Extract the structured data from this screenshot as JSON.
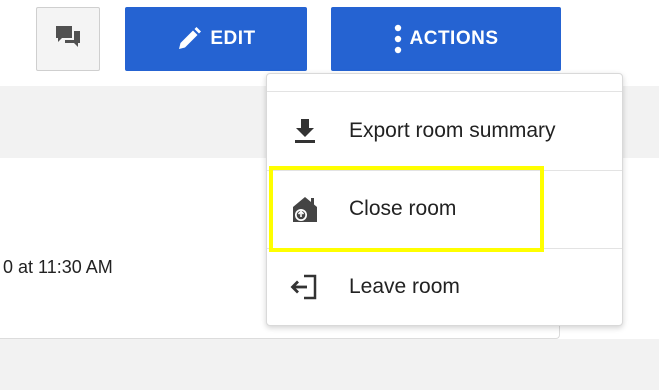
{
  "toolbar": {
    "chat_icon": "chat-bubbles-icon",
    "edit_icon": "pencil-icon",
    "edit_label": "EDIT",
    "actions_icon": "vertical-dots-icon",
    "actions_label": "ACTIONS",
    "button_color": "#2563d2"
  },
  "background": {
    "date_fragment": "0 at 11:30 AM"
  },
  "actions_menu": {
    "items": [
      {
        "label": "Export room summary",
        "icon": "download-icon"
      },
      {
        "label": "Close room",
        "icon": "close-room-house-icon",
        "highlighted": true
      },
      {
        "label": "Leave room",
        "icon": "leave-door-icon"
      }
    ],
    "highlight_color": "#ffff00"
  }
}
